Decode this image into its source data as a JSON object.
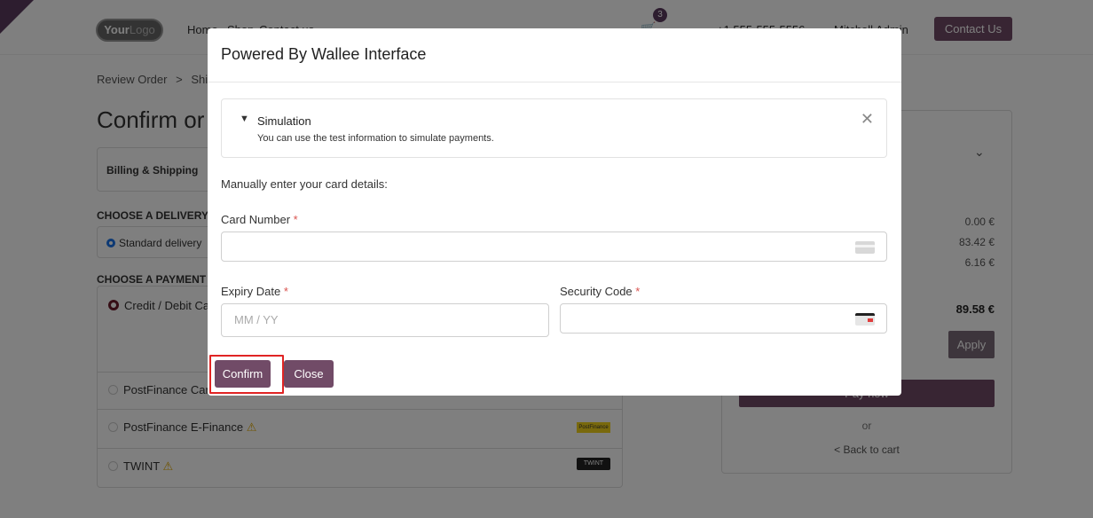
{
  "header": {
    "logo_main": "Your",
    "logo_sub": "Logo",
    "nav_home": "Home",
    "nav_shop": "Shop",
    "nav_contact": "Contact us",
    "cart_count": "3",
    "phone": "+1 555-555-5556",
    "user": "Mitchell Admin",
    "contact_button": "Contact Us"
  },
  "page": {
    "breadcrumb_1": "Review Order",
    "breadcrumb_sep": ">",
    "breadcrumb_2": "Shi",
    "heading": "Confirm or",
    "billing_label": "Billing & Shipping",
    "delivery_label": "CHOOSE A DELIVERY",
    "delivery_option": "Standard delivery",
    "payment_label": "CHOOSE A PAYMENT",
    "payment_credit": "Credit / Debit Ca",
    "payment_postcard": "PostFinance Card",
    "payment_efinance": "PostFinance E-Finance",
    "payment_twint": "TWINT",
    "warn_symbol": "⚠",
    "pf_badge": "PostFinance",
    "twint_badge": "TWINT"
  },
  "summary": {
    "value_1": "0.00 €",
    "value_2": "83.42 €",
    "value_3": "6.16 €",
    "total": "89.58 €",
    "apply": "Apply",
    "pay_now": "Pay now",
    "or": "or",
    "back": "< Back to cart"
  },
  "modal": {
    "title": "Powered By Wallee Interface",
    "sim_title": "Simulation",
    "sim_sub": "You can use the test information to simulate payments.",
    "manual_label": "Manually enter your card details:",
    "card_number_label": "Card Number",
    "expiry_label": "Expiry Date",
    "expiry_placeholder": "MM / YY",
    "security_label": "Security Code",
    "required_mark": "*",
    "confirm": "Confirm",
    "close": "Close"
  }
}
